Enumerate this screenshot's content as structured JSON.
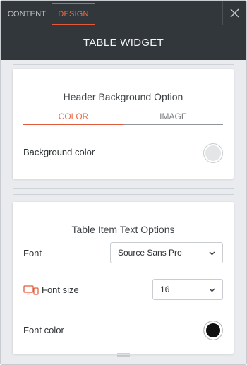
{
  "tabs": {
    "content_label": "CONTENT",
    "design_label": "DESIGN",
    "active": "DESIGN"
  },
  "header": {
    "title": "TABLE WIDGET"
  },
  "header_background": {
    "heading": "Header Background Option",
    "subtabs": {
      "color_label": "COLOR",
      "image_label": "IMAGE",
      "active": "COLOR"
    },
    "background_color_label": "Background color",
    "background_color_value": "#e3e5e7"
  },
  "item_text": {
    "heading": "Table Item Text Options",
    "font_label": "Font",
    "font_value": "Source Sans Pro",
    "font_size_label": "Font size",
    "font_size_value": "16",
    "font_color_label": "Font color",
    "font_color_value": "#111111"
  },
  "colors": {
    "accent": "#e25a3b",
    "topbar": "#31373b"
  },
  "icons": {
    "close": "close-icon",
    "chevron": "chevron-down-icon",
    "device": "monitor-icon",
    "handle": "resize-handle-icon"
  }
}
